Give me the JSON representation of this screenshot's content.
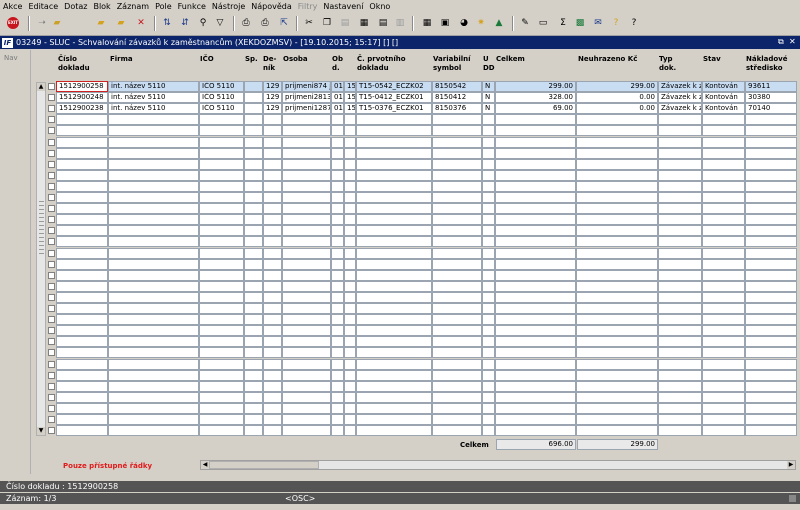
{
  "menu": [
    "Akce",
    "Editace",
    "Dotaz",
    "Blok",
    "Záznam",
    "Pole",
    "Funkce",
    "Nástroje",
    "Nápověda",
    "Filtry",
    "Nastavení",
    "Okno"
  ],
  "window": {
    "title": "03249 - SLUC - Schvalování závazků k zaměstnancům (XEKDOZMSV) - [19.10.2015; 15:17] [] []",
    "icon_text": "IF"
  },
  "nav": {
    "label": "Nav"
  },
  "columns": [
    {
      "label": "Číslo\ndokladu"
    },
    {
      "label": "Firma"
    },
    {
      "label": "IČO"
    },
    {
      "label": "Sp."
    },
    {
      "label": "De-\nník"
    },
    {
      "label": "Osoba"
    },
    {
      "label": "Ob\nd."
    },
    {
      "label": "Č. prvotního\ndokladu"
    },
    {
      "label": "Variabilní\nsymbol"
    },
    {
      "label": "U\nDD"
    },
    {
      "label": "Celkem"
    },
    {
      "label": "Neuhrazeno Kč"
    },
    {
      "label": "Typ\ndok."
    },
    {
      "label": "Stav"
    },
    {
      "label": "Nákladové\nstředisko"
    }
  ],
  "rows": [
    {
      "cislo": "1512900258",
      "firma": "int. název 5110",
      "ico": "IČO 5110",
      "sp": "",
      "denik": "129",
      "osoba": "prijmeni874 jm",
      "obd": "01",
      "obd2": "15",
      "prvotni": "T15-0542_ECZK02",
      "vs": "8150542",
      "udd": "N",
      "celkem": "299.00",
      "neuhrazeno": "299.00",
      "typ": "Závazek k z",
      "stav": "Kontován",
      "stredisko": "93611"
    },
    {
      "cislo": "1512900248",
      "firma": "int. název 5110",
      "ico": "IČO 5110",
      "sp": "",
      "denik": "129",
      "osoba": "prijmeni2813 j",
      "obd": "01",
      "obd2": "15",
      "prvotni": "T15-0412_ECZK01",
      "vs": "8150412",
      "udd": "N",
      "celkem": "328.00",
      "neuhrazeno": "0.00",
      "typ": "Závazek k z",
      "stav": "Kontován",
      "stredisko": "30380"
    },
    {
      "cislo": "1512900238",
      "firma": "int. název 5110",
      "ico": "IČO 5110",
      "sp": "",
      "denik": "129",
      "osoba": "prijmeni1287 j",
      "obd": "01",
      "obd2": "15",
      "prvotni": "T15-0376_ECZK01",
      "vs": "8150376",
      "udd": "N",
      "celkem": "69.00",
      "neuhrazeno": "0.00",
      "typ": "Závazek k z",
      "stav": "Kontován",
      "stredisko": "70140"
    }
  ],
  "totals": {
    "label": "Celkem",
    "celkem": "696.00",
    "neuhrazeno": "299.00"
  },
  "note": "Pouze přístupné řádky",
  "status": {
    "field": "Číslo dokladu : 1512900258",
    "record": "Záznam: 1/3",
    "osc": "<OSC>"
  }
}
